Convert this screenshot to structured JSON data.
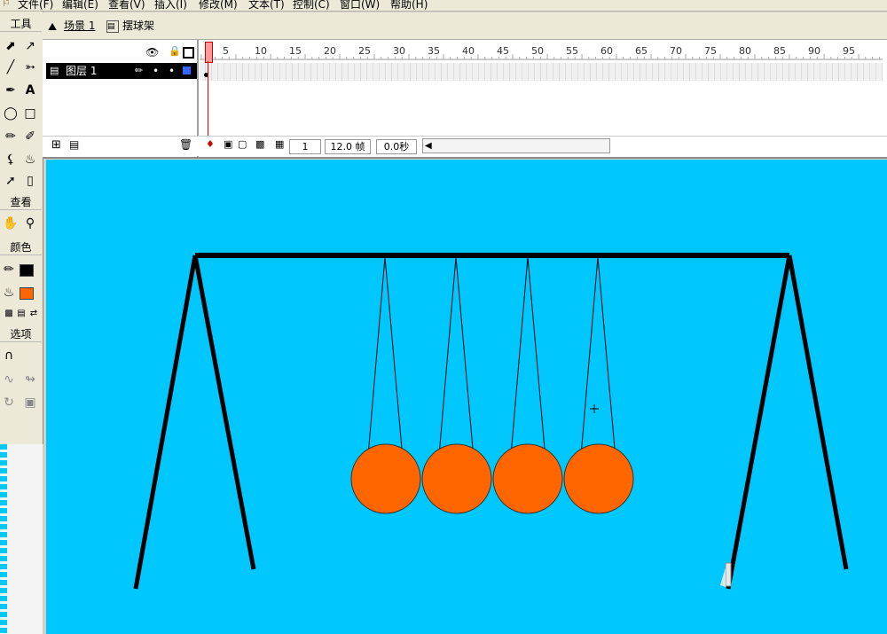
{
  "menu": {
    "app_icon": "flash-app-icon",
    "items": [
      "文件(F)",
      "编辑(E)",
      "查看(V)",
      "插入(I)",
      "修改(M)",
      "文本(T)",
      "控制(C)",
      "窗口(W)",
      "帮助(H)"
    ]
  },
  "toolbox": {
    "tools_label": "工具",
    "view_label": "查看",
    "colors_label": "颜色",
    "options_label": "选项",
    "stroke_color": "#000000",
    "fill_color": "#ff6600"
  },
  "breadcrumb": {
    "scene": "场景 1",
    "symbol": "摆球架"
  },
  "timeline": {
    "layer_name": "图层 1",
    "ruler_ticks": [
      "5",
      "10",
      "15",
      "20",
      "25",
      "30",
      "35",
      "40",
      "45",
      "50",
      "55",
      "60",
      "65",
      "70",
      "75",
      "80",
      "85",
      "90",
      "95"
    ],
    "current_frame": "1",
    "frame_rate": "12.0 帧",
    "elapsed_time": "0.0秒"
  },
  "colors": {
    "stage_bg": "#00c8ff",
    "ball": "#ff6600",
    "frame": "#000000"
  }
}
